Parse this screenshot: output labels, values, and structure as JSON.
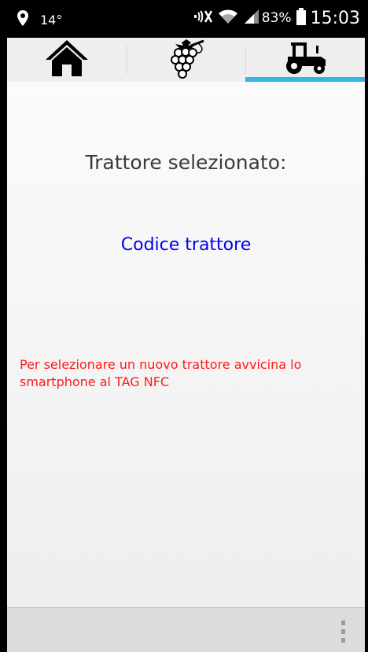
{
  "status_bar": {
    "temperature": "14°",
    "battery_percent": "83%",
    "clock": "15:03",
    "icons": [
      "location-icon",
      "mute-icon",
      "wifi-icon",
      "signal-icon",
      "battery-icon"
    ]
  },
  "tabs": [
    {
      "icon": "home-icon",
      "active": false
    },
    {
      "icon": "grapes-icon",
      "active": false
    },
    {
      "icon": "tractor-icon",
      "active": true
    }
  ],
  "main": {
    "heading": "Trattore selezionato:",
    "tractor_code": "Codice trattore",
    "instruction": "Per selezionare un nuovo trattore avvicina lo smartphone al TAG NFC"
  },
  "colors": {
    "accent": "#33b5e5",
    "code_text": "#0000ee",
    "instruction_text": "#ff1a1a"
  }
}
